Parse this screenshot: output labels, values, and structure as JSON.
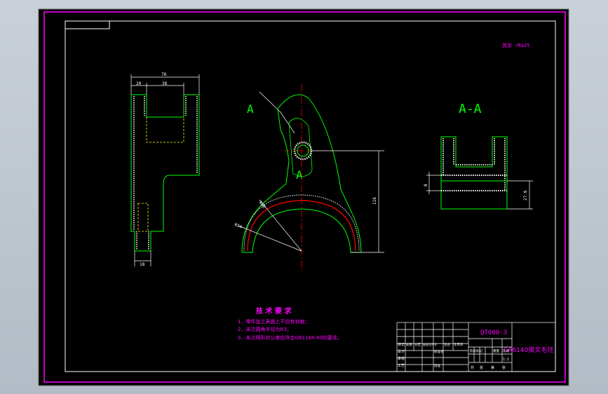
{
  "drawing": {
    "roughness_note": "其余 √Ra25",
    "part_label_a": "A",
    "part_label_a2": "A",
    "section_label": "A-A",
    "dims": {
      "overall_width": "78",
      "left_width": "20",
      "slot_width": "38",
      "base_width": "18",
      "height": "116",
      "r_outer": "R60",
      "r_inner": "R54",
      "section_small": "8",
      "section_height": "27.6"
    },
    "tech_requirements": {
      "title": "技 术 要 求",
      "items": [
        "1、零件加工表面上不应有划痕；",
        "2、未注圆角半径为R3；",
        "3、未注明形状公差应符合GB1184-80的要求。"
      ]
    },
    "title_block": {
      "drawing_no": "QT600-3",
      "part_name": "CA6140拨叉毛坯",
      "scale": "1:1",
      "row_labels": [
        "标记",
        "设计",
        "审核",
        "工艺"
      ],
      "sub_labels": [
        "处数",
        "分区",
        "更改文件号",
        "签名",
        "年月日"
      ],
      "std_label": "标准化",
      "approve_label": "批准",
      "stage_label": "阶段标记",
      "weight_label": "重量",
      "ratio_label": "比例",
      "sheet_labels": [
        "共",
        "张",
        "第",
        "张"
      ]
    }
  },
  "colors": {
    "background": "#000000",
    "border": "#ff00ff",
    "outline": "#ffffff",
    "part_green": "#00ff00",
    "hidden_yellow": "#ffff00",
    "center_red": "#ff0000",
    "dim_white": "#ffffff",
    "text_magenta": "#ff00ff"
  }
}
